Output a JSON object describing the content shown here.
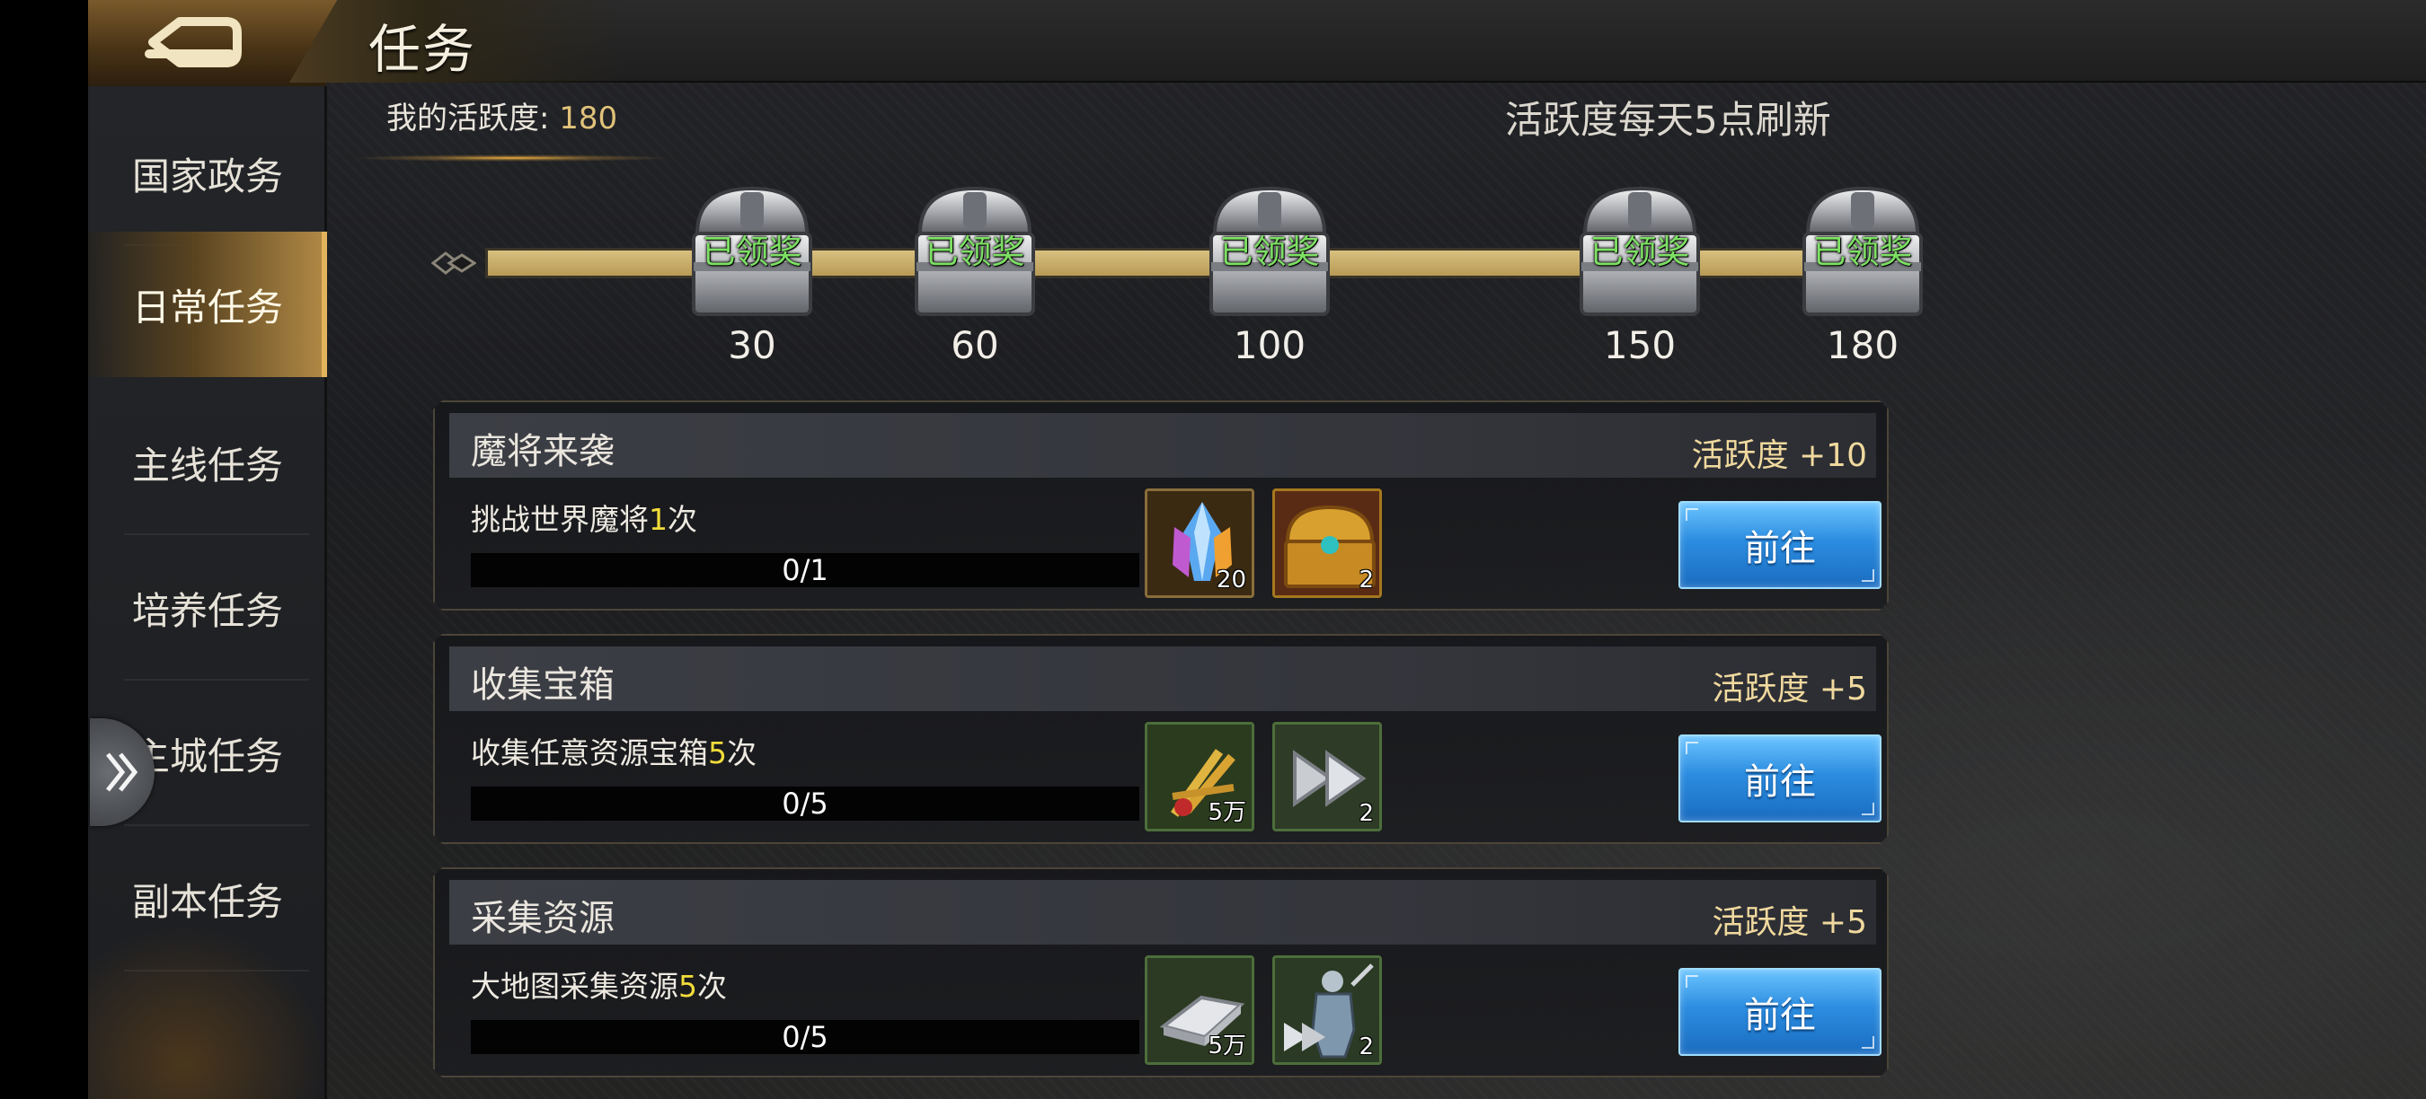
{
  "header": {
    "title": "任务"
  },
  "sidebar": {
    "items": [
      {
        "label": "国家政务",
        "active": false
      },
      {
        "label": "日常任务",
        "active": true
      },
      {
        "label": "主线任务",
        "active": false
      },
      {
        "label": "培养任务",
        "active": false
      },
      {
        "label": "主城任务",
        "active": false
      },
      {
        "label": "副本任务",
        "active": false
      }
    ]
  },
  "activity": {
    "label": "我的活跃度: ",
    "value": "180",
    "refresh_note": "活跃度每天5点刷新",
    "progress_fraction": 1.0,
    "chests": [
      {
        "status": "已领奖",
        "threshold": "30"
      },
      {
        "status": "已领奖",
        "threshold": "60"
      },
      {
        "status": "已领奖",
        "threshold": "100"
      },
      {
        "status": "已领奖",
        "threshold": "150"
      },
      {
        "status": "已领奖",
        "threshold": "180"
      }
    ]
  },
  "tasks": [
    {
      "name": "魔将来袭",
      "points": "活跃度 +10",
      "desc_before": "挑战世界魔将",
      "desc_num": "1",
      "desc_after": "次",
      "progress": "0/1",
      "rewards": [
        {
          "icon": "crystal-icon",
          "count": "20"
        },
        {
          "icon": "treasure-chest-icon",
          "count": "2"
        }
      ],
      "button": "前往"
    },
    {
      "name": "收集宝箱",
      "points": "活跃度 +5",
      "desc_before": "收集任意资源宝箱",
      "desc_num": "5",
      "desc_after": "次",
      "progress": "0/5",
      "rewards": [
        {
          "icon": "wheat-icon",
          "count": "5万"
        },
        {
          "icon": "speedup-icon",
          "count": "2"
        }
      ],
      "button": "前往"
    },
    {
      "name": "采集资源",
      "points": "活跃度 +5",
      "desc_before": "大地图采集资源",
      "desc_num": "5",
      "desc_after": "次",
      "progress": "0/5",
      "rewards": [
        {
          "icon": "iron-ingot-icon",
          "count": "5万"
        },
        {
          "icon": "soldier-speedup-icon",
          "count": "2"
        }
      ],
      "button": "前往"
    }
  ],
  "colors": {
    "accent_gold": "#e0c27a",
    "claimed_green": "#7ce063",
    "button_blue": "#2c8de0",
    "highlight_yellow": "#f2dc3a"
  }
}
